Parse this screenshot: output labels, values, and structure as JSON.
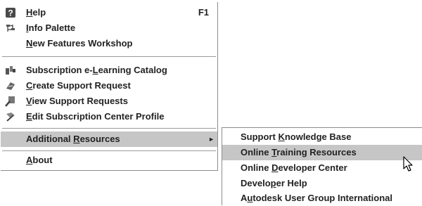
{
  "main_menu": {
    "items": [
      {
        "pre": "",
        "u": "H",
        "post": "elp",
        "shortcut": "F1",
        "icon": "help-book-icon"
      },
      {
        "pre": "",
        "u": "I",
        "post": "nfo Palette",
        "icon": "info-palette-icon"
      },
      {
        "pre": "",
        "u": "N",
        "post": "ew Features Workshop"
      },
      {
        "pre": "Subscription e-",
        "u": "L",
        "post": "earning Catalog",
        "icon": "elearning-catalog-icon"
      },
      {
        "pre": "",
        "u": "C",
        "post": "reate Support Request",
        "icon": "create-request-icon"
      },
      {
        "pre": "",
        "u": "V",
        "post": "iew Support Requests",
        "icon": "view-requests-icon"
      },
      {
        "pre": "",
        "u": "E",
        "post": "dit Subscription Center Profile",
        "icon": "edit-profile-icon"
      },
      {
        "pre": "Additional ",
        "u": "R",
        "post": "esources",
        "submenu_arrow": "►"
      },
      {
        "pre": "",
        "u": "A",
        "post": "bout"
      }
    ]
  },
  "sub_menu": {
    "items": [
      {
        "pre": "Support ",
        "u": "K",
        "post": "nowledge Base"
      },
      {
        "pre": "Online ",
        "u": "T",
        "post": "raining Resources"
      },
      {
        "pre": "Online ",
        "u": "D",
        "post": "eveloper Center"
      },
      {
        "pre": "Develo",
        "u": "p",
        "post": "er Help"
      },
      {
        "pre": "A",
        "u": "u",
        "post": "todesk User Group International"
      }
    ]
  },
  "colors": {
    "highlight": "#c6c6c6",
    "border": "#8c8c8c"
  }
}
